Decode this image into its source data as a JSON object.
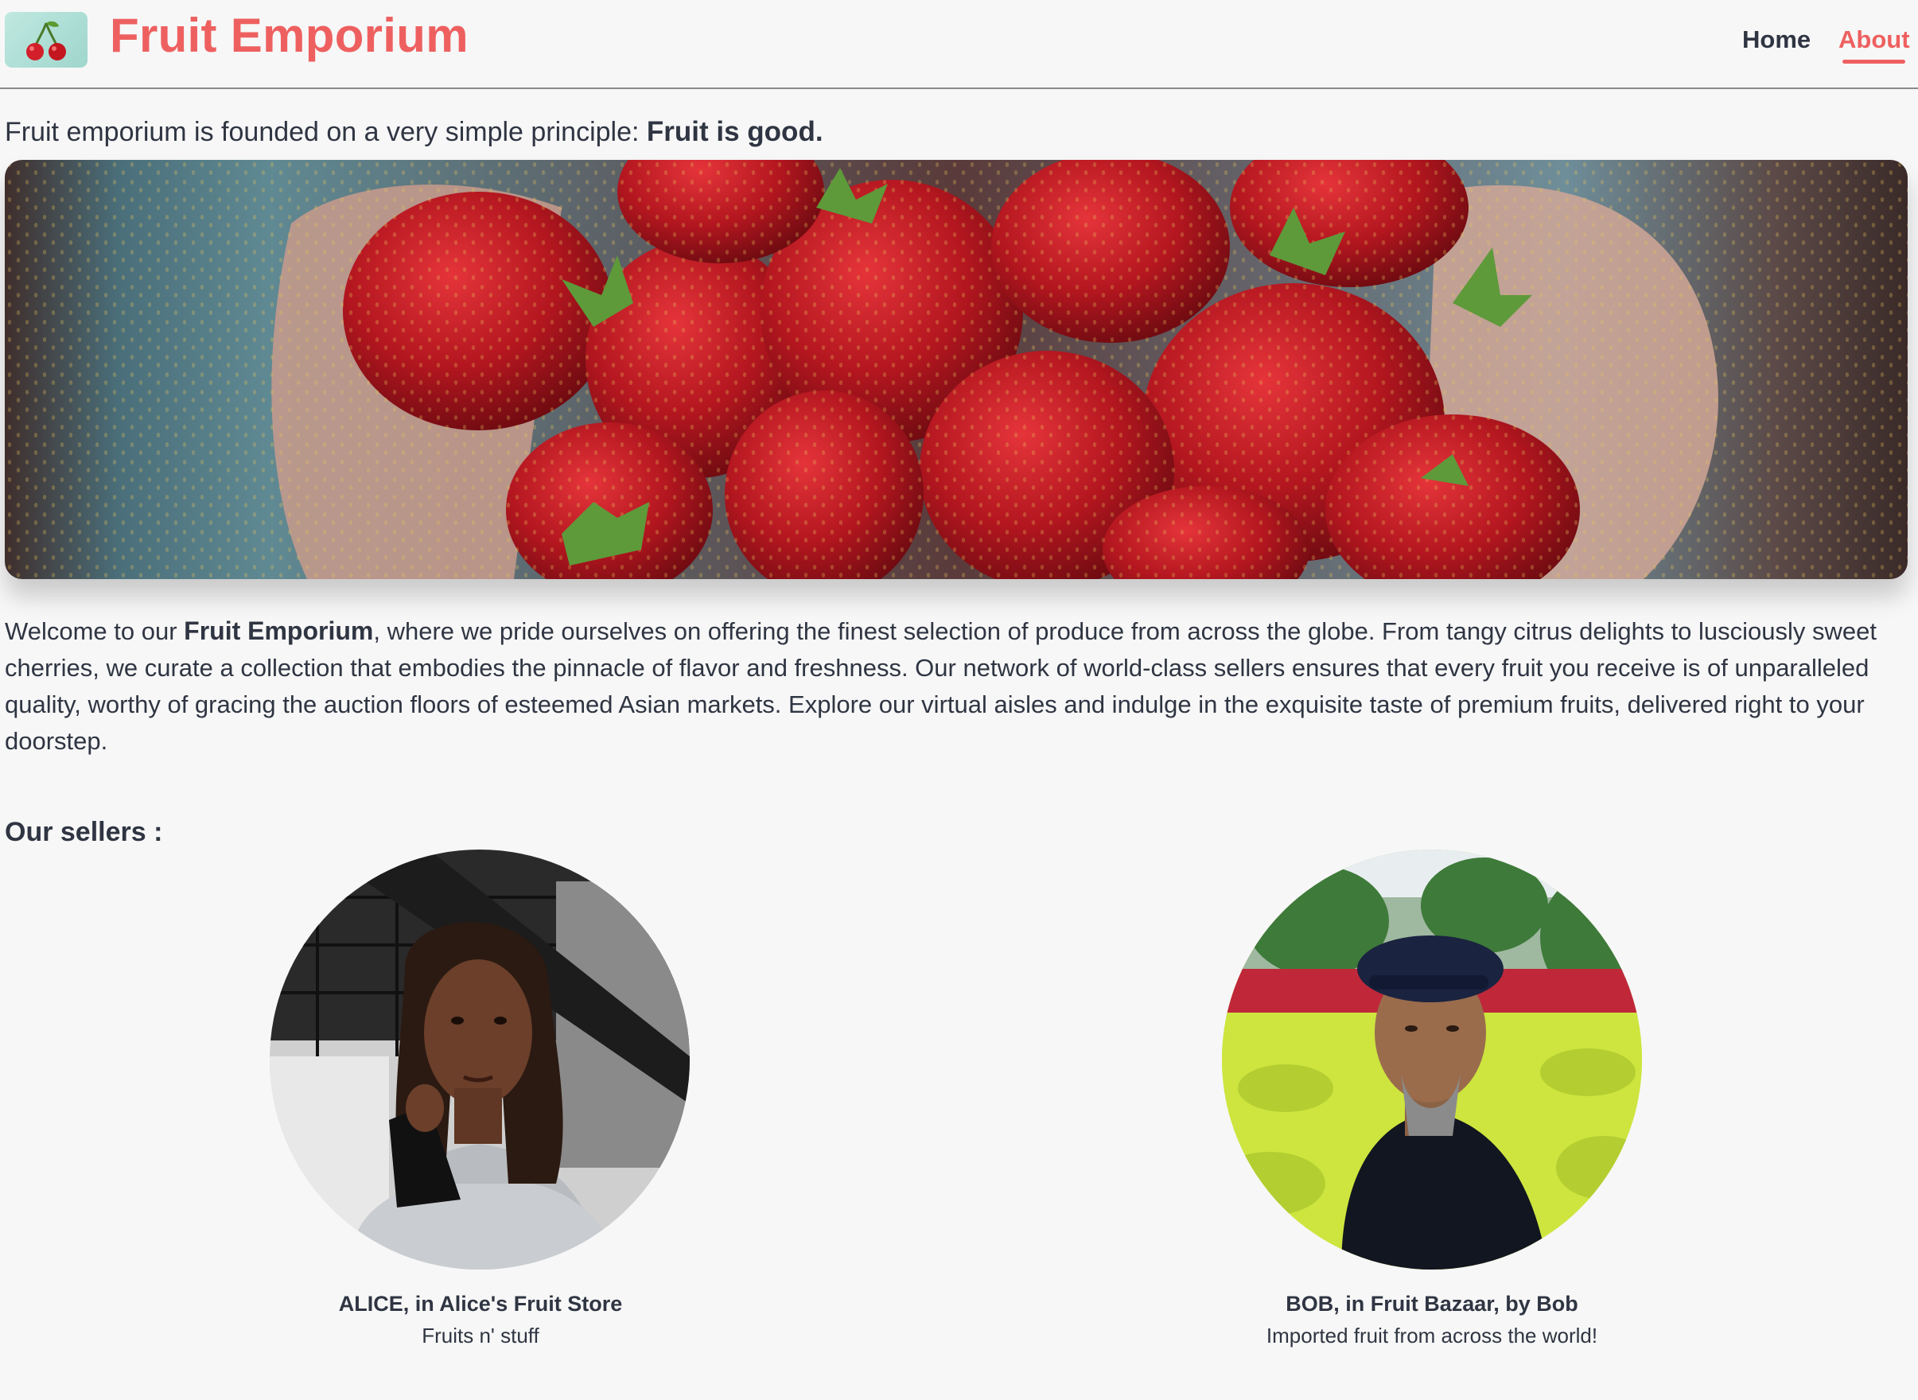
{
  "header": {
    "brand": "Fruit Emporium",
    "logo_icon": "cherry-icon",
    "nav": [
      {
        "label": "Home",
        "active": false
      },
      {
        "label": "About",
        "active": true
      }
    ]
  },
  "intro": {
    "text": "Fruit emporium is founded on a very simple principle: ",
    "emphasis": "Fruit is good."
  },
  "hero": {
    "icon": "strawberries-photo"
  },
  "welcome": {
    "lead": "Welcome to our ",
    "brand": "Fruit Emporium",
    "body": ", where we pride ourselves on offering the finest selection of produce from across the globe. From tangy citrus delights to lusciously sweet cherries, we curate a collection that embodies the pinnacle of flavor and freshness. Our network of world-class sellers ensures that every fruit you receive is of unparalleled quality, worthy of gracing the auction floors of esteemed Asian markets. Explore our virtual aisles and indulge in the exquisite taste of premium fruits, delivered right to your doorstep."
  },
  "sellers": {
    "title": "Our sellers :",
    "items": [
      {
        "name": "ALICE, in Alice's Fruit Store",
        "description": "Fruits n' stuff"
      },
      {
        "name": "BOB, in Fruit Bazaar, by Bob",
        "description": "Imported fruit from across the world!"
      }
    ]
  },
  "colors": {
    "accent": "#ee6060",
    "text": "#2f3542",
    "background": "#f7f7f7",
    "logo_bg": "#a8dcd2"
  }
}
